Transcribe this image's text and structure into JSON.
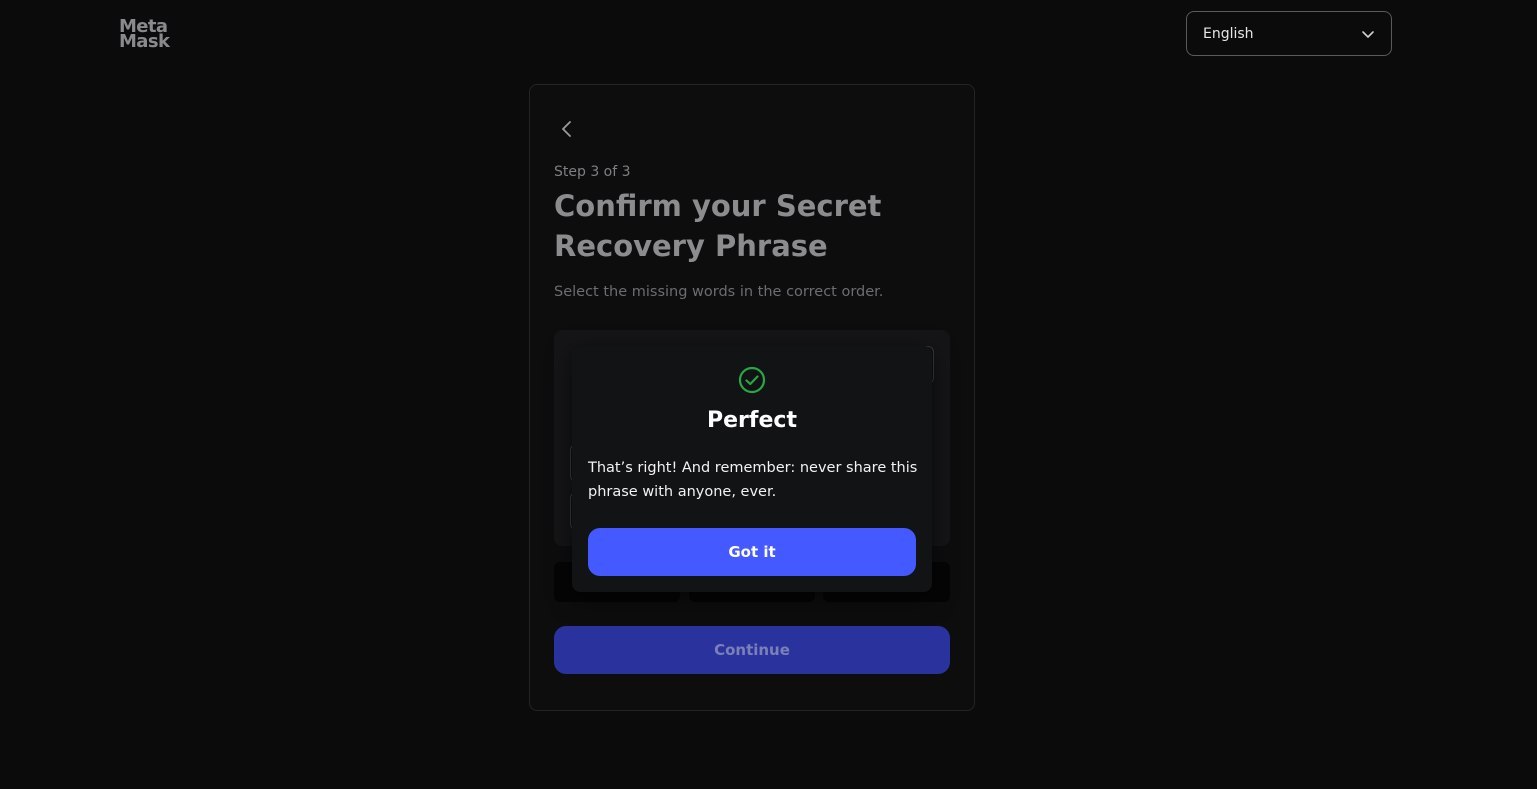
{
  "header": {
    "logo_line1": "Meta",
    "logo_line2": "Mask",
    "language": {
      "selected": "English",
      "icon": "chevron-down-icon"
    }
  },
  "card": {
    "back_icon": "chevron-left-icon",
    "step": "Step 3 of 3",
    "title": "Confirm your Secret Recovery Phrase",
    "subtitle": "Select the missing words in the correct order.",
    "continue_label": "Continue"
  },
  "modal": {
    "icon": "check-circle-icon",
    "title": "Perfect",
    "body": "That’s right! And remember: never share this phrase with anyone, ever.",
    "button_label": "Got it"
  },
  "colors": {
    "background": "#0b0b0c",
    "primary": "#4459ff",
    "primary_disabled": "#2a339d",
    "success": "#28a745"
  }
}
